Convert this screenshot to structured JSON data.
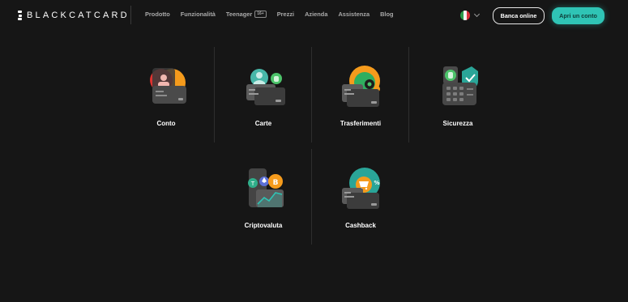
{
  "header": {
    "brand": "BLACKCATCARD",
    "nav": [
      {
        "label": "Prodotto"
      },
      {
        "label": "Funzionalità"
      },
      {
        "label": "Teenager",
        "badge": "16+"
      },
      {
        "label": "Prezzi"
      },
      {
        "label": "Azienda"
      },
      {
        "label": "Assistenza"
      },
      {
        "label": "Blog"
      }
    ],
    "language": "italian-flag-icon",
    "login_label": "Banca online",
    "cta_label": "Apri un conto"
  },
  "features": [
    {
      "label": "Conto",
      "icon": "account-illustration-icon"
    },
    {
      "label": "Carte",
      "icon": "cards-illustration-icon"
    },
    {
      "label": "Trasferimenti",
      "icon": "transfers-illustration-icon"
    },
    {
      "label": "Sicurezza",
      "icon": "security-illustration-icon"
    },
    {
      "label": "Criptovaluta",
      "icon": "crypto-illustration-icon"
    },
    {
      "label": "Cashback",
      "icon": "cashback-illustration-icon"
    }
  ],
  "colors": {
    "background": "#161616",
    "accent": "#2fc4b5",
    "orange": "#f59b1c",
    "green": "#4cc36a"
  }
}
